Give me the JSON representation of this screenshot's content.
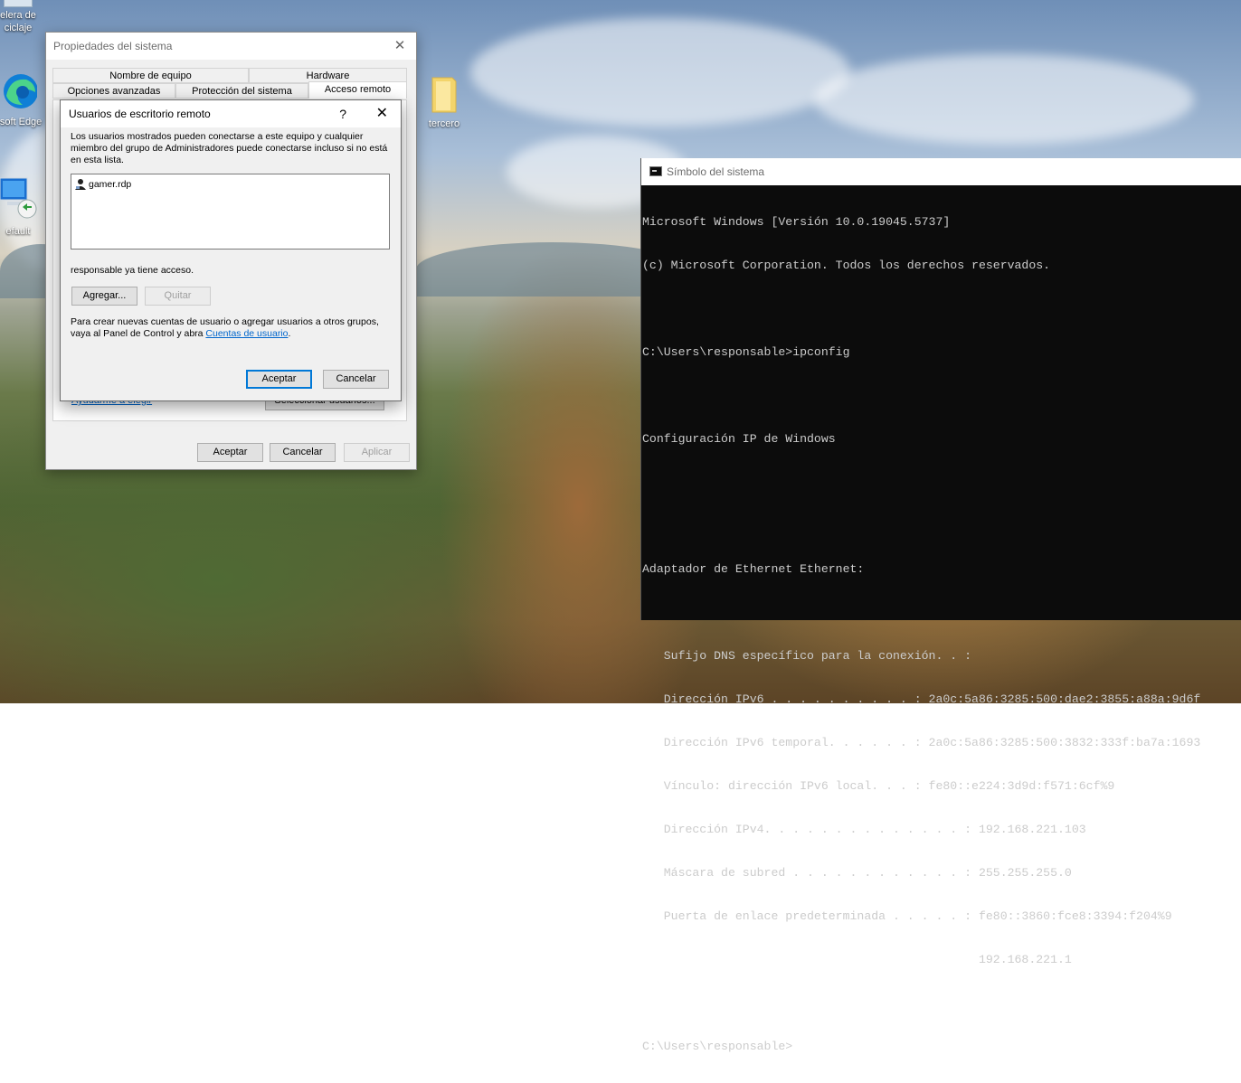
{
  "desktop": {
    "icons": [
      {
        "id": "recycle-bin",
        "label": "elera de\nciclaje"
      },
      {
        "id": "edge",
        "label": "osoft Edge"
      },
      {
        "id": "default-rdp",
        "label": "efault"
      },
      {
        "id": "tercero",
        "label": "tercero"
      }
    ]
  },
  "system_properties": {
    "title": "Propiedades del sistema",
    "tabs_row1": [
      "Nombre de equipo",
      "Hardware"
    ],
    "tabs_row2": [
      "Opciones avanzadas",
      "Protección del sistema",
      "Acceso remoto"
    ],
    "active_tab": "Acceso remoto",
    "help_link": "Ayudarme a elegir",
    "select_users_button": "Seleccionar usuarios...",
    "buttons": {
      "ok": "Aceptar",
      "cancel": "Cancelar",
      "apply": "Aplicar"
    }
  },
  "remote_users_dialog": {
    "title": "Usuarios de escritorio remoto",
    "help_symbol": "?",
    "close_symbol": "✕",
    "description": "Los usuarios mostrados pueden conectarse a este equipo y cualquier miembro del grupo de Administradores puede conectarse incluso si no está en esta lista.",
    "users": [
      "gamer.rdp"
    ],
    "access_note": "responsable ya tiene acceso.",
    "add_button": "Agregar...",
    "remove_button": "Quitar",
    "footer_text": "Para crear nuevas cuentas de usuario o agregar usuarios a otros grupos, vaya al Panel de Control y abra ",
    "footer_link": "Cuentas de usuario",
    "footer_end": ".",
    "ok_button": "Aceptar",
    "cancel_button": "Cancelar"
  },
  "cmd": {
    "title": "Símbolo del sistema",
    "lines": [
      "Microsoft Windows [Versión 10.0.19045.5737]",
      "(c) Microsoft Corporation. Todos los derechos reservados.",
      "",
      "C:\\Users\\responsable>ipconfig",
      "",
      "Configuración IP de Windows",
      "",
      "",
      "Adaptador de Ethernet Ethernet:",
      "",
      "   Sufijo DNS específico para la conexión. . :",
      "   Dirección IPv6 . . . . . . . . . . : 2a0c:5a86:3285:500:dae2:3855:a88a:9d6f",
      "   Dirección IPv6 temporal. . . . . . : 2a0c:5a86:3285:500:3832:333f:ba7a:1693",
      "   Vínculo: dirección IPv6 local. . . : fe80::e224:3d9d:f571:6cf%9",
      "   Dirección IPv4. . . . . . . . . . . . . . : 192.168.221.103",
      "   Máscara de subred . . . . . . . . . . . . : 255.255.255.0",
      "   Puerta de enlace predeterminada . . . . . : fe80::3860:fce8:3394:f204%9",
      "                                               192.168.221.1",
      "",
      "C:\\Users\\responsable>"
    ]
  }
}
